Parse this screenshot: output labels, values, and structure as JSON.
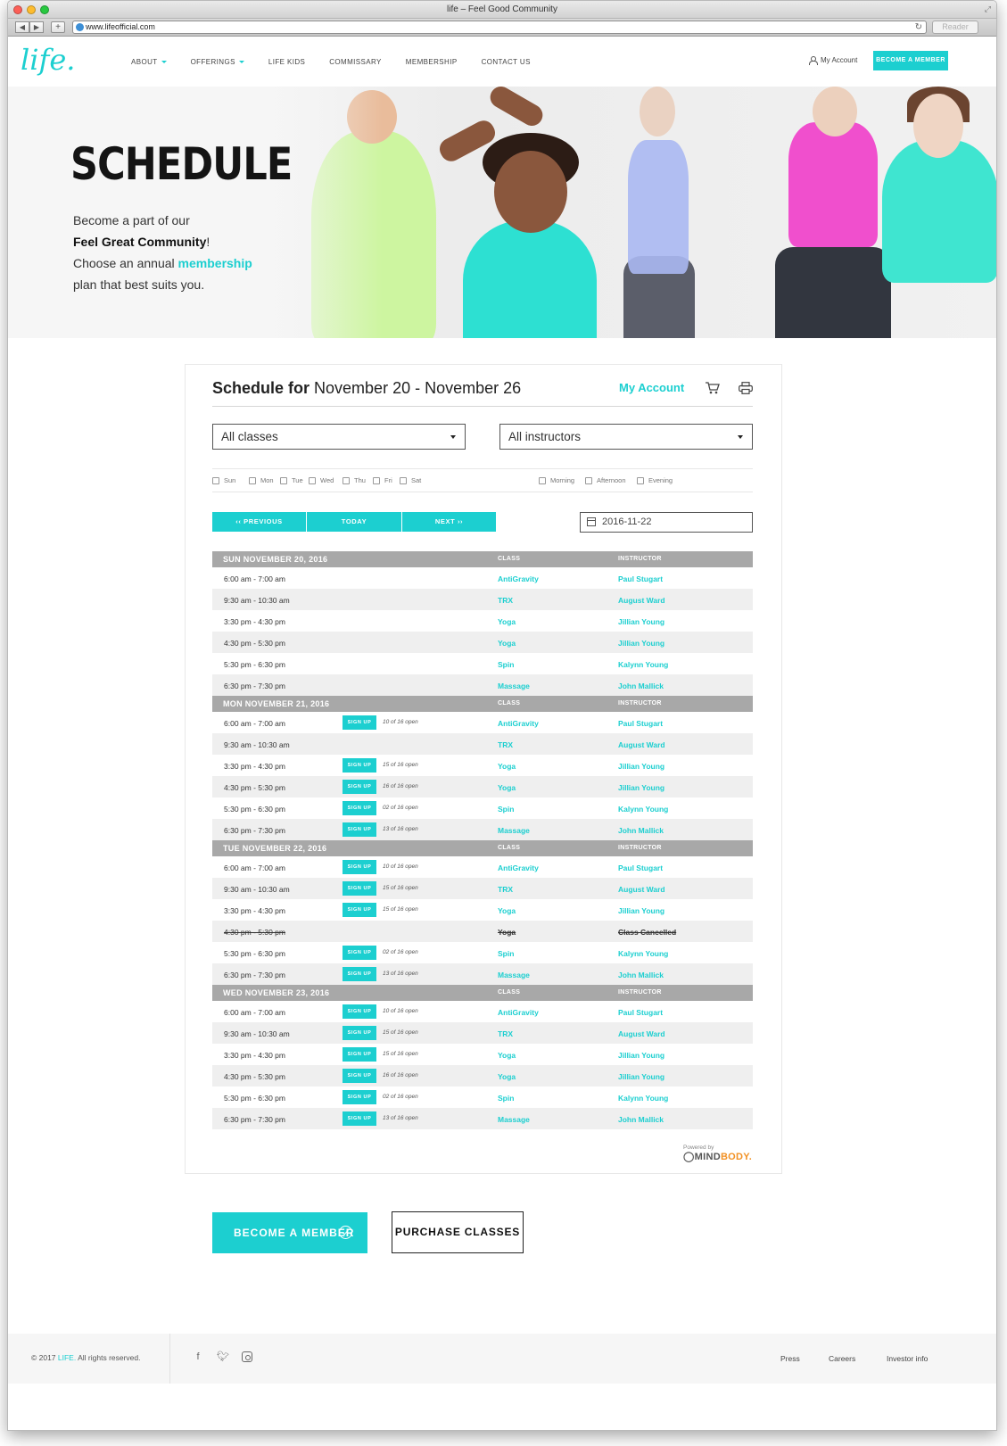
{
  "browser": {
    "title": "life – Feel Good Community",
    "url": "www.lifeofficial.com",
    "reader_label": "Reader"
  },
  "header": {
    "logo": "life.",
    "nav": [
      {
        "label": "ABOUT",
        "dropdown": true
      },
      {
        "label": "OFFERINGS",
        "dropdown": true
      },
      {
        "label": "LIFE KIDS",
        "dropdown": false
      },
      {
        "label": "COMMISSARY",
        "dropdown": false
      },
      {
        "label": "MEMBERSHIP",
        "dropdown": false
      },
      {
        "label": "CONTACT US",
        "dropdown": false
      }
    ],
    "my_account": "My Account",
    "become_member": "BECOME A MEMBER"
  },
  "hero": {
    "title": "SCHEDULE",
    "line1": "Become a part of our",
    "line2_strong": "Feel Great Community",
    "line2_tail": "!",
    "line3_pre": "Choose an annual ",
    "line3_accent": "membership",
    "line4": "plan that best suits you."
  },
  "schedule": {
    "title_bold": "Schedule for",
    "title_range": " November 20 - November 26",
    "my_account": "My Account",
    "class_select": "All classes",
    "instructor_select": "All instructors",
    "days": [
      "Sun",
      "Mon",
      "Tue",
      "Wed",
      "Thu",
      "Fri",
      "Sat"
    ],
    "times_of_day": [
      "Morning",
      "Afternoon",
      "Evening"
    ],
    "prev_label": "‹‹ PREVIOUS",
    "today_label": "TODAY",
    "next_label": "NEXT ››",
    "date_value": "2016-11-22",
    "class_header": "CLASS",
    "instructor_header": "INSTRUCTOR",
    "signup_label": "SIGN UP",
    "groups": [
      {
        "date": "SUN NOVEMBER 20, 2016",
        "rows": [
          {
            "time": "6:00 am - 7:00 am",
            "signup": false,
            "spots": "",
            "class": "AntiGravity",
            "instructor": "Paul Stugart"
          },
          {
            "time": "9:30 am - 10:30 am",
            "signup": false,
            "spots": "",
            "class": "TRX",
            "instructor": "August Ward"
          },
          {
            "time": "3:30 pm - 4:30 pm",
            "signup": false,
            "spots": "",
            "class": "Yoga",
            "instructor": "Jillian Young"
          },
          {
            "time": "4:30 pm - 5:30 pm",
            "signup": false,
            "spots": "",
            "class": "Yoga",
            "instructor": "Jillian Young"
          },
          {
            "time": "5:30 pm - 6:30 pm",
            "signup": false,
            "spots": "",
            "class": "Spin",
            "instructor": "Kalynn Young"
          },
          {
            "time": "6:30 pm - 7:30 pm",
            "signup": false,
            "spots": "",
            "class": "Massage",
            "instructor": "John Mallick"
          }
        ]
      },
      {
        "date": "MON NOVEMBER 21, 2016",
        "rows": [
          {
            "time": "6:00 am - 7:00 am",
            "signup": true,
            "spots": "10 of 16 open",
            "class": "AntiGravity",
            "instructor": "Paul Stugart"
          },
          {
            "time": "9:30 am - 10:30 am",
            "signup": false,
            "spots": "",
            "class": "TRX",
            "instructor": "August Ward"
          },
          {
            "time": "3:30 pm - 4:30 pm",
            "signup": true,
            "spots": "15 of 16 open",
            "class": "Yoga",
            "instructor": "Jillian Young"
          },
          {
            "time": "4:30 pm - 5:30 pm",
            "signup": true,
            "spots": "16 of 16 open",
            "class": "Yoga",
            "instructor": "Jillian Young"
          },
          {
            "time": "5:30 pm - 6:30 pm",
            "signup": true,
            "spots": "02 of 16 open",
            "class": "Spin",
            "instructor": "Kalynn Young"
          },
          {
            "time": "6:30 pm - 7:30 pm",
            "signup": true,
            "spots": "13 of 16 open",
            "class": "Massage",
            "instructor": "John Mallick"
          }
        ]
      },
      {
        "date": "TUE NOVEMBER 22, 2016",
        "rows": [
          {
            "time": "6:00 am - 7:00 am",
            "signup": true,
            "spots": "10 of 16 open",
            "class": "AntiGravity",
            "instructor": "Paul Stugart"
          },
          {
            "time": "9:30 am - 10:30 am",
            "signup": true,
            "spots": "15 of 16 open",
            "class": "TRX",
            "instructor": "August Ward"
          },
          {
            "time": "3:30 pm - 4:30 pm",
            "signup": true,
            "spots": "15 of 16 open",
            "class": "Yoga",
            "instructor": "Jillian Young"
          },
          {
            "time": "4:30 pm - 5:30 pm",
            "signup": false,
            "spots": "",
            "class": "Yoga",
            "instructor": "Class Cancelled",
            "cancelled": true
          },
          {
            "time": "5:30 pm - 6:30 pm",
            "signup": true,
            "spots": "02 of 16 open",
            "class": "Spin",
            "instructor": "Kalynn Young"
          },
          {
            "time": "6:30 pm - 7:30 pm",
            "signup": true,
            "spots": "13 of 16 open",
            "class": "Massage",
            "instructor": "John Mallick"
          }
        ]
      },
      {
        "date": "WED NOVEMBER 23, 2016",
        "rows": [
          {
            "time": "6:00 am - 7:00 am",
            "signup": true,
            "spots": "10 of 16 open",
            "class": "AntiGravity",
            "instructor": "Paul Stugart"
          },
          {
            "time": "9:30 am - 10:30 am",
            "signup": true,
            "spots": "15 of 16 open",
            "class": "TRX",
            "instructor": "August Ward"
          },
          {
            "time": "3:30 pm - 4:30 pm",
            "signup": true,
            "spots": "15 of 16 open",
            "class": "Yoga",
            "instructor": "Jillian Young"
          },
          {
            "time": "4:30 pm - 5:30 pm",
            "signup": true,
            "spots": "16 of 16 open",
            "class": "Yoga",
            "instructor": "Jillian Young"
          },
          {
            "time": "5:30 pm - 6:30 pm",
            "signup": true,
            "spots": "02 of 16 open",
            "class": "Spin",
            "instructor": "Kalynn Young"
          },
          {
            "time": "6:30 pm - 7:30 pm",
            "signup": true,
            "spots": "13 of 16 open",
            "class": "Massage",
            "instructor": "John Mallick"
          }
        ]
      }
    ],
    "powered_by": "Powered by",
    "mindbody_a": "MIND",
    "mindbody_b": "BODY."
  },
  "cta": {
    "become_member": "BECOME A MEMBER",
    "purchase_classes": "PURCHASE CLASSES"
  },
  "footer": {
    "copyright_pre": "© 2017 ",
    "brand": "LIFE.",
    "copyright_post": " All rights reserved.",
    "links": [
      "Press",
      "Careers",
      "Investor info"
    ],
    "social_icons": [
      "facebook-icon",
      "twitter-icon",
      "instagram-icon"
    ]
  },
  "colors": {
    "accent": "#1ccfd0",
    "header_grey": "#a8a8a8",
    "mindbody_orange": "#f29124"
  }
}
